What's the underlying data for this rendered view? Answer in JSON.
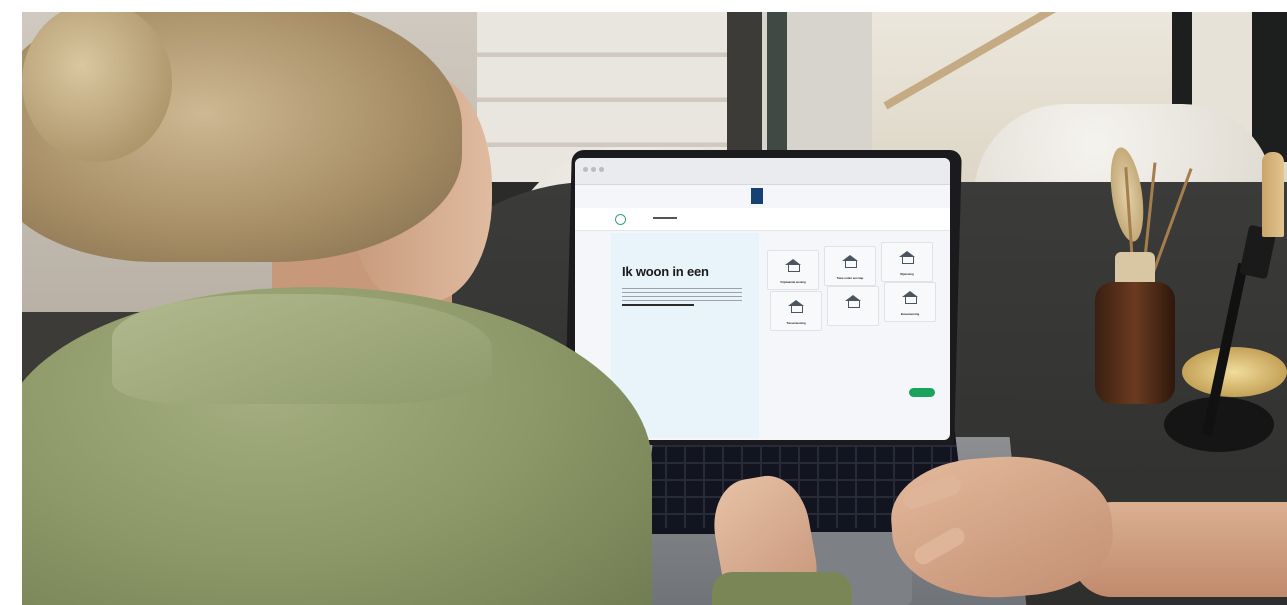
{
  "scene": {
    "description_tag": "photo-laptop-on-table"
  },
  "screen": {
    "hero_title": "Ik woon in een",
    "cards": [
      {
        "label": "Vrijstaande woning",
        "icon": "house-icon"
      },
      {
        "label": "Twee onder een kap",
        "icon": "semi-detached-icon"
      },
      {
        "label": "Rijwoning",
        "icon": "row-house-icon"
      },
      {
        "label": "Tussenwoning",
        "icon": "house-icon"
      },
      {
        "label": "",
        "icon": "apartment-icon"
      },
      {
        "label": "Bovenwoning",
        "icon": "upstairs-house-icon"
      }
    ]
  },
  "colors": {
    "accent_green": "#1aa35a",
    "hero_bg": "#e8f3fa",
    "gov_blue": "#154273"
  }
}
